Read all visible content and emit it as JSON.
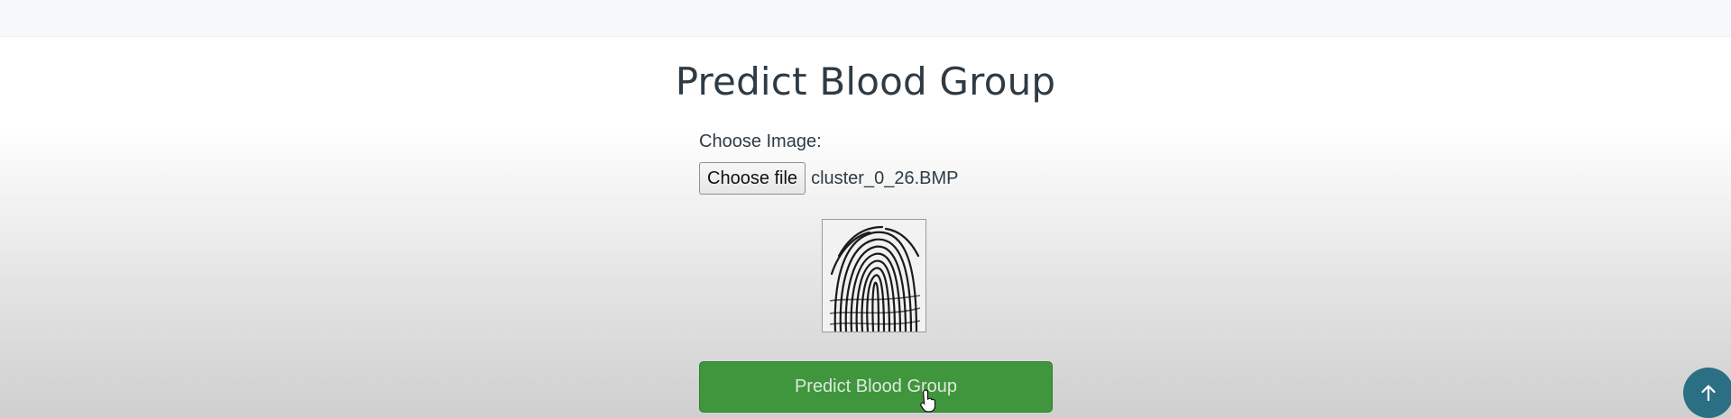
{
  "page": {
    "title": "Predict Blood Group"
  },
  "form": {
    "image_label": "Choose Image:",
    "file_button_label": "Choose file",
    "selected_file": "cluster_0_26.BMP",
    "submit_label": "Predict Blood Group"
  },
  "icons": {
    "preview": "fingerprint-image",
    "scroll_top": "arrow-up-icon",
    "cursor": "hand-pointer-icon"
  },
  "colors": {
    "title_text": "#2f3b44",
    "submit_background": "#3f963c",
    "scroll_top_background": "#2b6f85"
  }
}
